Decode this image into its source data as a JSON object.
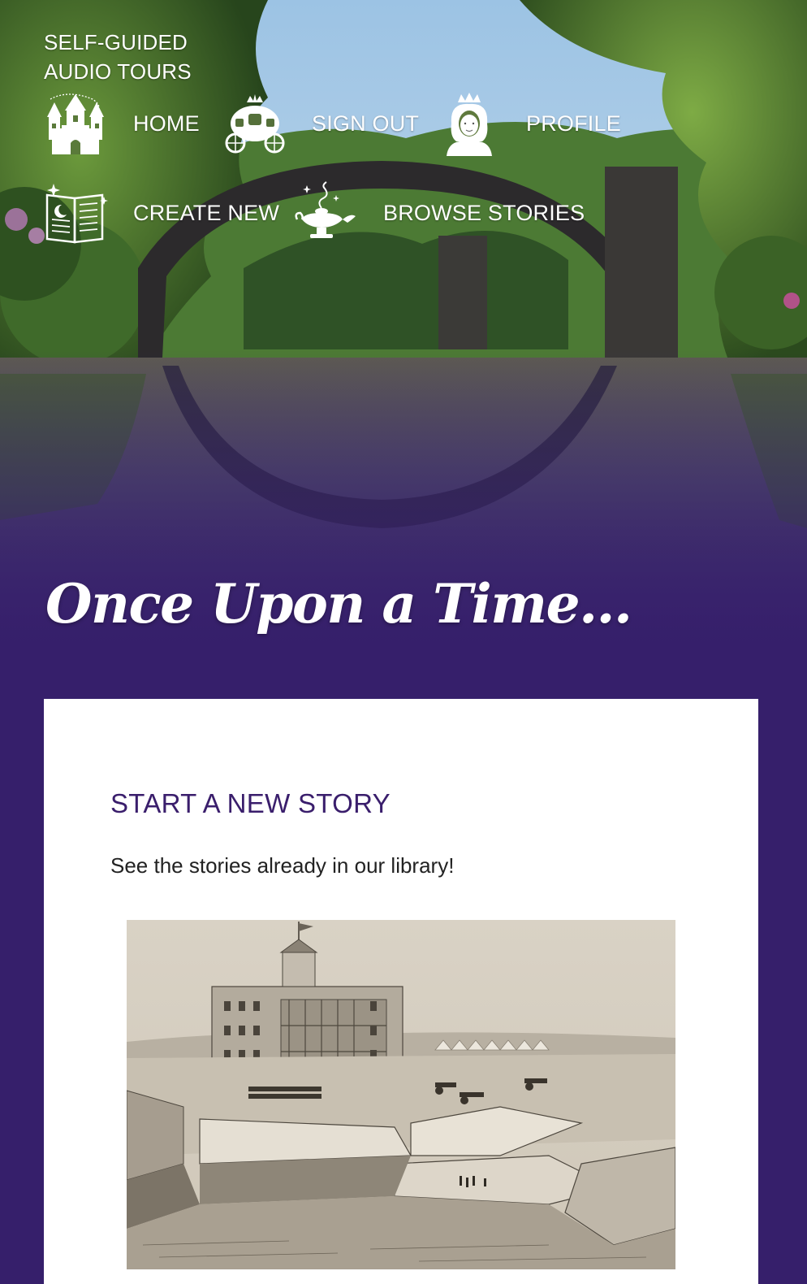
{
  "brand": {
    "line1": "SELF-GUIDED",
    "line2": "AUDIO TOURS"
  },
  "nav": {
    "home": {
      "label": "HOME",
      "icon": "castle-icon"
    },
    "sign_out": {
      "label": "SIGN OUT",
      "icon": "carriage-icon"
    },
    "profile": {
      "label": "PROFILE",
      "icon": "princess-icon"
    },
    "create_new": {
      "label": "CREATE NEW",
      "icon": "storybook-icon"
    },
    "browse": {
      "label": "BROWSE STORIES",
      "icon": "magic-lamp-icon"
    }
  },
  "hero": {
    "title": "Once Upon a Time..."
  },
  "card": {
    "title": "START A NEW STORY",
    "text": "See the stories already in our library!"
  },
  "colors": {
    "purple": "#361f6b",
    "title_purple": "#3a1e6c",
    "white": "#ffffff"
  }
}
